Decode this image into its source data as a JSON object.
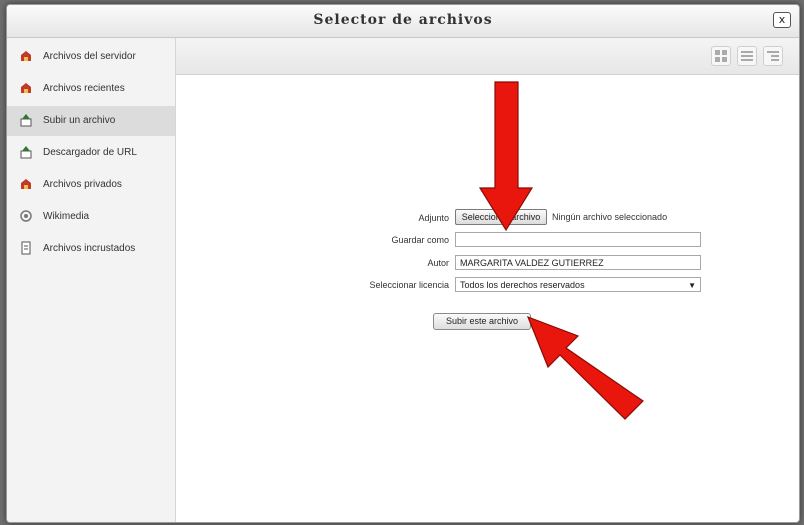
{
  "dialog": {
    "title": "Selector de archivos",
    "close_label": "x"
  },
  "sidebar": {
    "items": [
      {
        "label": "Archivos del servidor",
        "icon": "server-files-icon"
      },
      {
        "label": "Archivos recientes",
        "icon": "recent-files-icon"
      },
      {
        "label": "Subir un archivo",
        "icon": "upload-icon",
        "active": true
      },
      {
        "label": "Descargador de URL",
        "icon": "url-download-icon"
      },
      {
        "label": "Archivos privados",
        "icon": "private-files-icon"
      },
      {
        "label": "Wikimedia",
        "icon": "wikimedia-icon"
      },
      {
        "label": "Archivos incrustados",
        "icon": "embedded-files-icon"
      }
    ]
  },
  "toolbar": {
    "views": [
      "icon-view",
      "list-view",
      "tree-view"
    ]
  },
  "form": {
    "attachment_label": "Adjunto",
    "choose_file_label": "Seleccionar archivo",
    "file_status": "Ningún archivo seleccionado",
    "save_as_label": "Guardar como",
    "save_as_value": "",
    "author_label": "Autor",
    "author_value": "MARGARITA VALDEZ GUTIERREZ",
    "license_label": "Seleccionar licencia",
    "license_value": "Todos los derechos reservados",
    "upload_button_label": "Subir este archivo"
  },
  "annotations": {
    "arrow_color": "#e8160c"
  }
}
